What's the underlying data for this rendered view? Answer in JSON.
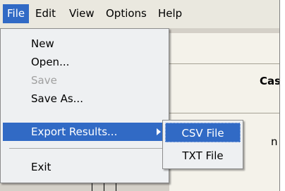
{
  "menubar": {
    "items": [
      {
        "label": "File"
      },
      {
        "label": "Edit"
      },
      {
        "label": "View"
      },
      {
        "label": "Options"
      },
      {
        "label": "Help"
      }
    ]
  },
  "file_menu": {
    "items": [
      {
        "label": "New",
        "enabled": true
      },
      {
        "label": "Open...",
        "enabled": true
      },
      {
        "label": "Save",
        "enabled": false
      },
      {
        "label": "Save As...",
        "enabled": true
      },
      {
        "label": "Export Results...",
        "enabled": true,
        "submenu": true
      },
      {
        "label": "Exit",
        "enabled": true
      }
    ]
  },
  "export_submenu": {
    "items": [
      {
        "label": "CSV File"
      },
      {
        "label": "TXT File"
      }
    ]
  },
  "background": {
    "heading_fragment": "Cas",
    "text_fragment": "n"
  },
  "colors": {
    "highlight": "#316ac5",
    "menu_bg": "#eef0f2",
    "menubar_bg": "#eae8df",
    "disabled_text": "#a0a0a0"
  }
}
